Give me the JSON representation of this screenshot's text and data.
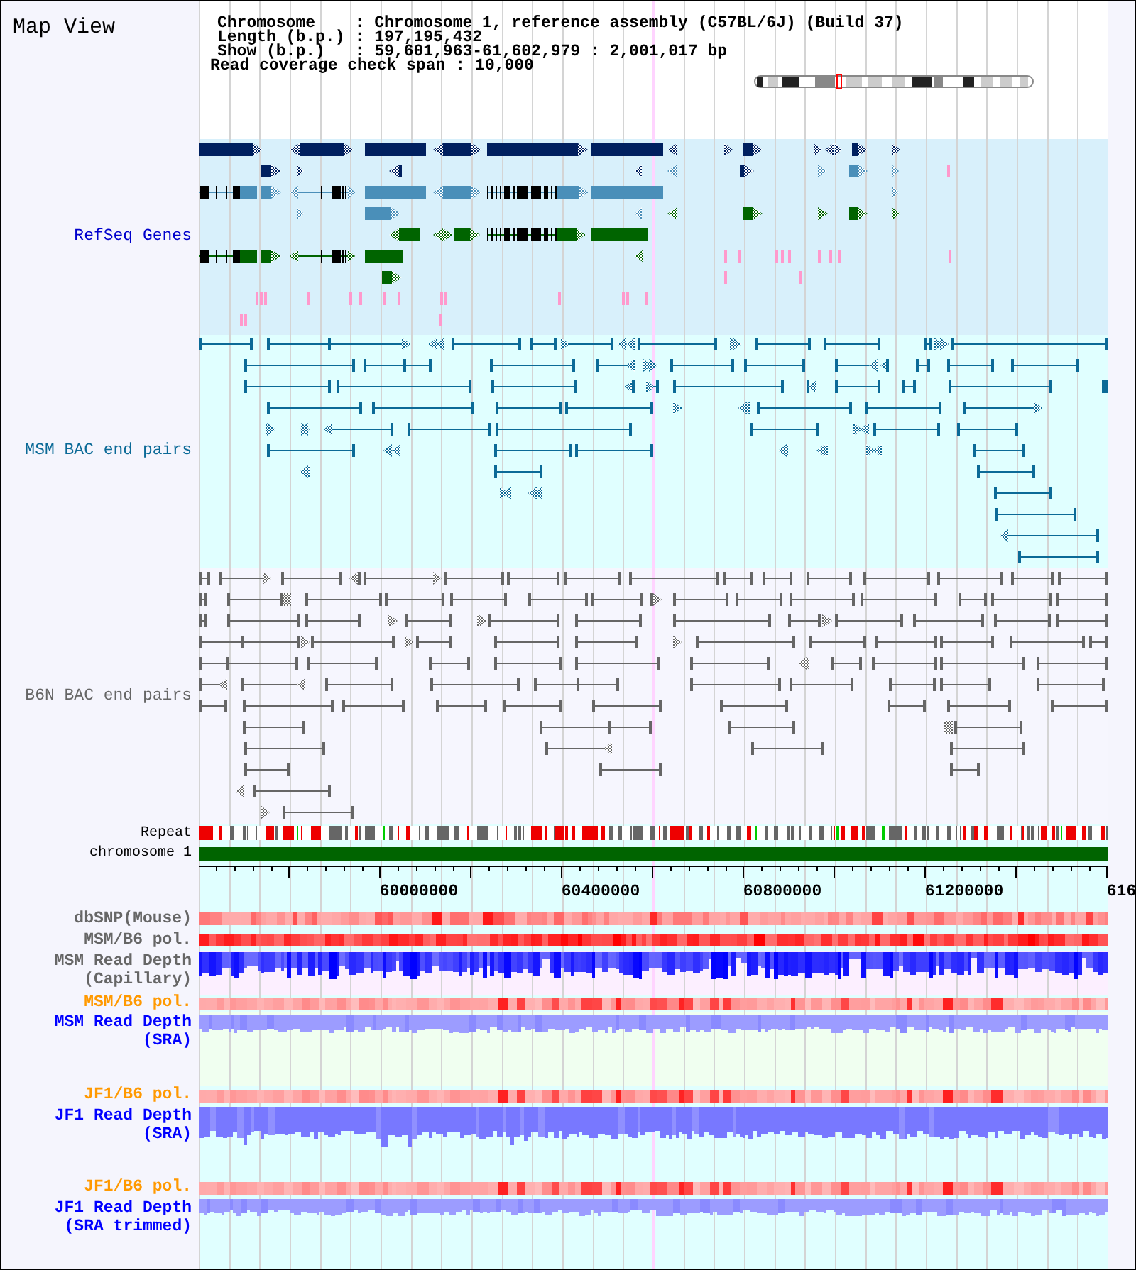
{
  "title": "Map View",
  "header": {
    "rows": [
      {
        "label": "Chromosome",
        "sep": ":",
        "value": "Chromosome 1, reference assembly (C57BL/6J) (Build 37)"
      },
      {
        "label": "Length (b.p.)",
        "sep": ":",
        "value": "197,195,432"
      },
      {
        "label": "Show (b.p.)",
        "sep": ":",
        "value": "59,601,963-61,602,979 : 2,001,017 bp"
      }
    ],
    "coverage_span": {
      "label": "Read coverage check span",
      "sep": ":",
      "value": "10,000"
    }
  },
  "tracks": [
    {
      "kind": "genes",
      "label": "RefSeq Genes",
      "color": "#0000cc"
    },
    {
      "kind": "bac_pairs",
      "label": "MSM BAC end pairs",
      "color": "#0b6a97"
    },
    {
      "kind": "bac_pairs",
      "label": "B6N BAC end pairs",
      "color": "#666666"
    },
    {
      "kind": "repeat",
      "label": "Repeat",
      "color": "#000000"
    },
    {
      "kind": "chromosome",
      "label": "chromosome 1",
      "color": "#000000"
    },
    {
      "kind": "axis",
      "tick_labels": [
        "60000000",
        "60400000",
        "60800000",
        "61200000",
        "616"
      ]
    },
    {
      "kind": "heat_strip",
      "label": "dbSNP(Mouse)",
      "color": "#666666"
    },
    {
      "kind": "heat_strip",
      "label": "MSM/B6 pol.",
      "color": "#666666"
    },
    {
      "kind": "depth",
      "label": "MSM Read Depth",
      "sublabel": "(Capillary)",
      "color": "#666666"
    },
    {
      "kind": "heat_strip",
      "label": "MSM/B6 pol.",
      "color": "#ff9900"
    },
    {
      "kind": "depth",
      "label": "MSM Read Depth",
      "sublabel": "(SRA)",
      "color": "#0000ff"
    },
    {
      "kind": "heat_strip",
      "label": "JF1/B6 pol.",
      "color": "#ff9900"
    },
    {
      "kind": "depth",
      "label": "JF1 Read Depth",
      "sublabel": "(SRA)",
      "color": "#0000ff"
    },
    {
      "kind": "heat_strip",
      "label": "JF1/B6 pol.",
      "color": "#ff9900"
    },
    {
      "kind": "depth",
      "label": "JF1 Read Depth",
      "sublabel": "(SRA trimmed)",
      "color": "#0000ff"
    }
  ]
}
